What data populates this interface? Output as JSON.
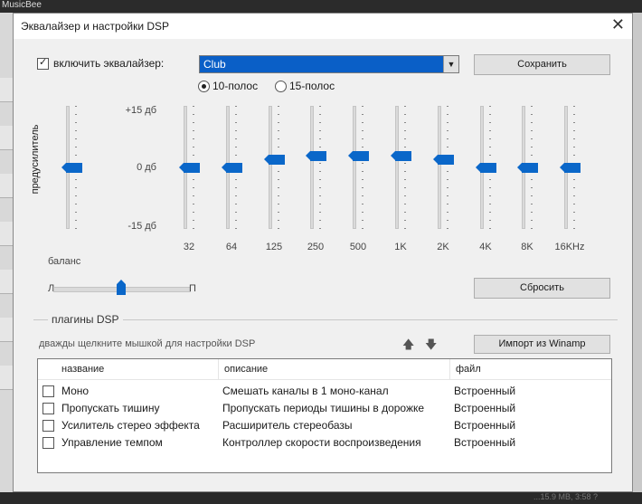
{
  "background": {
    "app_title": "MusicBee",
    "status_text": "...15.9 MB, 3:58 ?"
  },
  "dialog": {
    "title": "Эквалайзер и настройки DSP",
    "close_glyph": "✕"
  },
  "equalizer": {
    "enable_label": "включить эквалайзер:",
    "enabled": true,
    "preset": "Club",
    "save_label": "Сохранить",
    "reset_label": "Сбросить",
    "band_modes": [
      {
        "label": "10-полос",
        "selected": true
      },
      {
        "label": "15-полос",
        "selected": false
      }
    ],
    "preamp_label": "предусилитель",
    "scale": {
      "top": "+15 дб",
      "mid": "0 дб",
      "bottom": "-15 дб"
    },
    "range_db": [
      -15,
      15
    ],
    "preamp_db": 0,
    "bands": [
      {
        "label": "32",
        "db": 0
      },
      {
        "label": "64",
        "db": 0
      },
      {
        "label": "125",
        "db": 2
      },
      {
        "label": "250",
        "db": 3
      },
      {
        "label": "500",
        "db": 3
      },
      {
        "label": "1K",
        "db": 3
      },
      {
        "label": "2K",
        "db": 2
      },
      {
        "label": "4K",
        "db": 0
      },
      {
        "label": "8K",
        "db": 0
      },
      {
        "label": "16KHz",
        "db": 0
      }
    ],
    "balance": {
      "label": "баланс",
      "left_marker": "Л",
      "right_marker": "П",
      "value_fraction": 0.5
    }
  },
  "dsp": {
    "group_label": "плагины DSP",
    "hint": "дважды щелкните мышкой для настройки DSP",
    "import_label": "Импорт из Winamp",
    "up_glyph": "🡅",
    "down_glyph": "🡇",
    "columns": [
      "название",
      "описание",
      "файл"
    ],
    "rows": [
      {
        "name": "Моно",
        "description": "Смешать каналы в 1 моно-канал",
        "file": "Встроенный",
        "checked": false
      },
      {
        "name": "Пропускать тишину",
        "description": "Пропускать периоды тишины в дорожке",
        "file": "Встроенный",
        "checked": false
      },
      {
        "name": "Усилитель стерео эффекта",
        "description": "Расширитель стереобазы",
        "file": "Встроенный",
        "checked": false
      },
      {
        "name": "Управление темпом",
        "description": "Контроллер скорости воспроизведения",
        "file": "Встроенный",
        "checked": false
      }
    ]
  }
}
